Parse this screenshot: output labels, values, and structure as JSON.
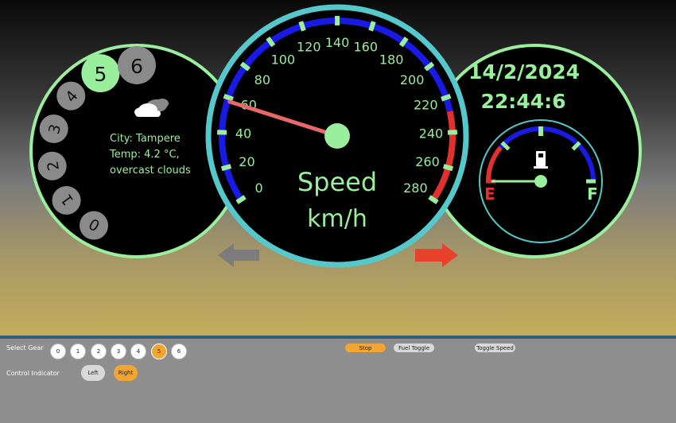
{
  "gear_dial": {
    "gears": [
      "0",
      "1",
      "2",
      "3",
      "4",
      "5",
      "6"
    ],
    "active_gear": "5"
  },
  "weather": {
    "city_line": "City: Tampere",
    "temp_line": "Temp: 4.2 °C,",
    "desc_line": "overcast clouds",
    "icon": "cloud-icon"
  },
  "speedometer": {
    "ticks": [
      "0",
      "20",
      "40",
      "60",
      "80",
      "100",
      "120",
      "140",
      "160",
      "180",
      "200",
      "220",
      "240",
      "260",
      "280"
    ],
    "title": "Speed",
    "unit": "km/h",
    "current_speed": 58
  },
  "clock": {
    "date": "14/2/2024",
    "time": "22:44:6"
  },
  "fuel": {
    "empty_label": "E",
    "full_label": "F",
    "level": 0.0,
    "icon": "fuel-pump-icon"
  },
  "indicators": {
    "left_active": false,
    "right_active": true
  },
  "colors": {
    "accent_green": "#99ef9c",
    "ring_cyan": "#55c8cc",
    "scale_blue": "#1a1ae6",
    "redline": "#e03030",
    "needle": "#e86767",
    "active_orange": "#f2a532",
    "indicator_on": "#e8412c",
    "indicator_off": "#7c7c7c"
  },
  "controls": {
    "select_gear_label": "Select Gear",
    "control_indicator_label": "Control Indicator",
    "gear_buttons": [
      "0",
      "1",
      "2",
      "3",
      "4",
      "5",
      "6"
    ],
    "active_gear_button": "5",
    "left_label": "Left",
    "right_label": "Right",
    "stop_label": "Stop",
    "fuel_toggle_label": "Fuel Toggle",
    "toggle_speed_label": "Toggle Speed"
  }
}
